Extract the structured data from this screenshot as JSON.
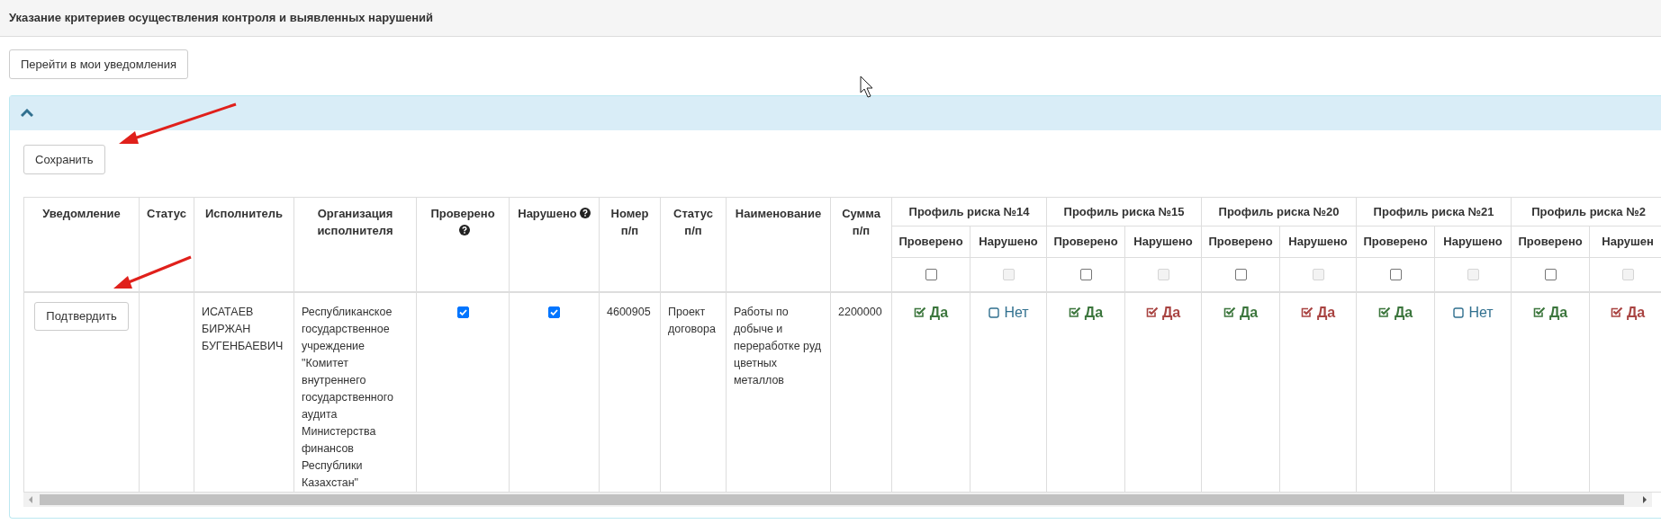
{
  "page_title": "Указание критериев осуществления контроля и выявленных нарушений",
  "nav_button": "Перейти в мои уведомления",
  "panel": {
    "expanded": true,
    "save_button": "Сохранить",
    "table": {
      "columns": [
        {
          "label": "Уведомление",
          "help": false
        },
        {
          "label": "Статус",
          "help": false
        },
        {
          "label": "Исполнитель",
          "help": false
        },
        {
          "label": "Организация исполнителя",
          "help": false
        },
        {
          "label": "Проверено",
          "help": true
        },
        {
          "label": "Нарушено",
          "help": true
        },
        {
          "label": "Номер п/п",
          "help": false
        },
        {
          "label": "Статус п/п",
          "help": false
        },
        {
          "label": "Наименование",
          "help": false
        },
        {
          "label": "Сумма п/п",
          "help": false
        }
      ],
      "profiles": [
        {
          "title": "Профиль риска №14",
          "subcolumns": [
            "Проверено",
            "Нарушено"
          ],
          "filters": [
            {
              "checked": false,
              "disabled": false
            },
            {
              "checked": false,
              "disabled": true
            }
          ]
        },
        {
          "title": "Профиль риска №15",
          "subcolumns": [
            "Проверено",
            "Нарушено"
          ],
          "filters": [
            {
              "checked": false,
              "disabled": false
            },
            {
              "checked": false,
              "disabled": true
            }
          ]
        },
        {
          "title": "Профиль риска №20",
          "subcolumns": [
            "Проверено",
            "Нарушено"
          ],
          "filters": [
            {
              "checked": false,
              "disabled": false
            },
            {
              "checked": false,
              "disabled": true
            }
          ]
        },
        {
          "title": "Профиль риска №21",
          "subcolumns": [
            "Проверено",
            "Нарушено"
          ],
          "filters": [
            {
              "checked": false,
              "disabled": false
            },
            {
              "checked": false,
              "disabled": true
            }
          ]
        },
        {
          "title": "Профиль риска №2",
          "subcolumns": [
            "Проверено",
            "Нарушен"
          ],
          "filters": [
            {
              "checked": false,
              "disabled": false
            },
            {
              "checked": false,
              "disabled": true
            }
          ]
        }
      ],
      "rows": [
        {
          "cells": [
            {
              "kind": "button",
              "text": "Подтвердить"
            },
            {
              "kind": "blank"
            },
            {
              "kind": "text",
              "text": "ИСАТАЕВ БИРЖАН БУГЕНБАЕВИЧ"
            },
            {
              "kind": "text",
              "text": "Республиканское государственное учреждение \"Комитет внутреннего государственного аудита Министерства финансов Республики Казахстан\""
            },
            {
              "kind": "checkbox",
              "checked": true
            },
            {
              "kind": "checkbox",
              "checked": true
            },
            {
              "kind": "text",
              "text": "4600905"
            },
            {
              "kind": "text",
              "text": "Проект договора"
            },
            {
              "kind": "text",
              "text": "Работы по добыче и переработке руд цветных металлов"
            },
            {
              "kind": "text",
              "text": "2200000"
            }
          ],
          "profile_values": [
            {
              "label": "Да",
              "checked": true,
              "color": "#3c763d"
            },
            {
              "label": "Нет",
              "checked": false,
              "color": "#31708f"
            },
            {
              "label": "Да",
              "checked": true,
              "color": "#3c763d"
            },
            {
              "label": "Да",
              "checked": true,
              "color": "#a94442"
            },
            {
              "label": "Да",
              "checked": true,
              "color": "#3c763d"
            },
            {
              "label": "Да",
              "checked": true,
              "color": "#a94442"
            },
            {
              "label": "Да",
              "checked": true,
              "color": "#3c763d"
            },
            {
              "label": "Нет",
              "checked": false,
              "color": "#31708f"
            },
            {
              "label": "Да",
              "checked": true,
              "color": "#3c763d"
            },
            {
              "label": "Да",
              "checked": true,
              "color": "#a94442"
            }
          ]
        }
      ]
    }
  }
}
